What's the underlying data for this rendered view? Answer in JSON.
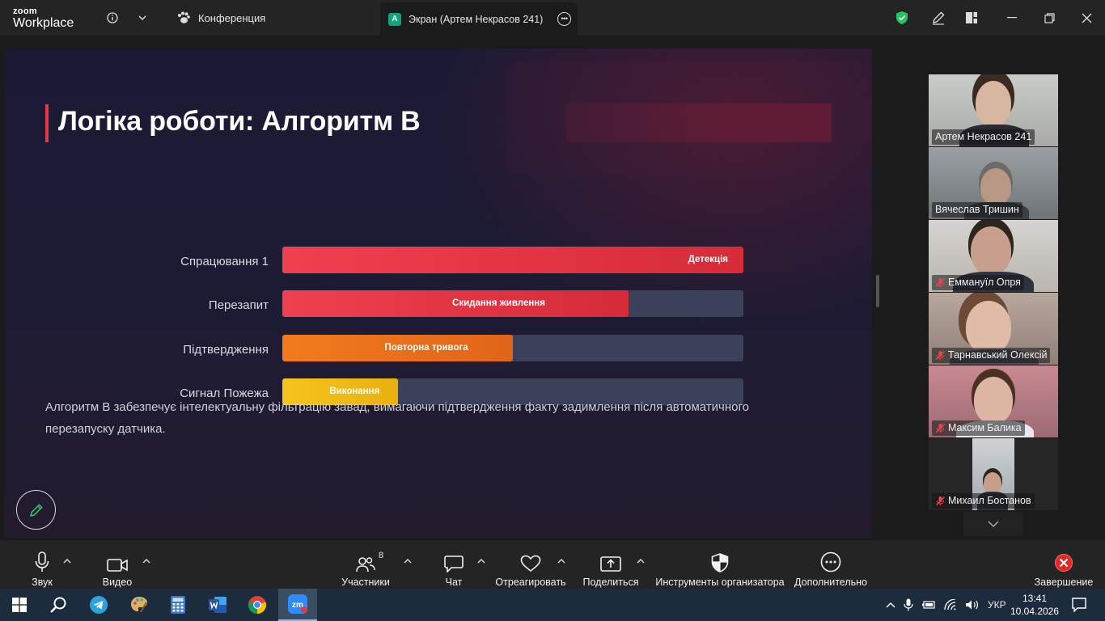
{
  "titlebar": {
    "logo_top": "zoom",
    "logo_bottom": "Workplace",
    "tab_conference": "Конференция",
    "tab_screen_avatar": "А",
    "tab_screen": "Экран (Артем Некрасов 241)"
  },
  "slide": {
    "title": "Логіка роботи: Алгоритм B",
    "rows": [
      {
        "label": "Спрацювання 1",
        "bar_text": "Детекція",
        "progress": 1.0
      },
      {
        "label": "Перезапит",
        "bar_text": "Скидання живлення",
        "progress": 0.75
      },
      {
        "label": "Підтвердження",
        "bar_text": "Повторна тривога",
        "progress": 0.5
      },
      {
        "label": "Сигнал Пожежа",
        "bar_text": "Виконання",
        "progress": 0.25
      }
    ],
    "description": "Алгоритм B забезпечує інтелектуальну фільтрацію завад, вимагаючи підтвердження факту задимлення після автоматичного перезапуску датчика.",
    "colors": {
      "red": "#e8394a",
      "orange": "#f07a1f",
      "yellow": "#f2c01a",
      "track": "#3a4158"
    }
  },
  "participants": [
    {
      "name": "Артем Некрасов 241",
      "muted": false,
      "active": false
    },
    {
      "name": "Вячеслав Тришин",
      "muted": false,
      "active": true
    },
    {
      "name": "Еммануїл Опря",
      "muted": true,
      "active": false
    },
    {
      "name": "Тарнавський Олексій",
      "muted": true,
      "active": false
    },
    {
      "name": "Максим Балика",
      "muted": true,
      "active": false
    },
    {
      "name": "Михаил Бостанов",
      "muted": true,
      "active": false
    }
  ],
  "toolbar": {
    "audio": "Звук",
    "video": "Видео",
    "participants": "Участники",
    "participants_count": "8",
    "chat": "Чат",
    "react": "Отреагировать",
    "share": "Поделиться",
    "host_tools": "Инструменты организатора",
    "more": "Дополнительно",
    "end": "Завершение"
  },
  "taskbar": {
    "language": "УКР",
    "time": "13:41",
    "date": "10.04.2026"
  }
}
